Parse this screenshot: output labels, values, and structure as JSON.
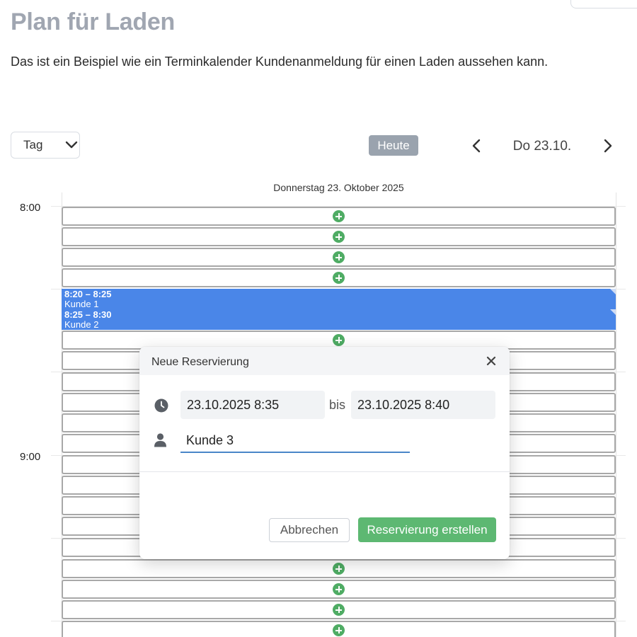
{
  "page": {
    "title": "Plan für Laden",
    "description": "Das ist ein Beispiel wie ein Terminkalender Kundenanmeldung für einen Laden aussehen kann."
  },
  "toolbar": {
    "view_label": "Tag",
    "today_label": "Heute",
    "current_date": "Do 23.10."
  },
  "calendar": {
    "day_header": "Donnerstag 23. Oktober 2025",
    "time_labels": [
      "8:00",
      "9:00"
    ],
    "events": [
      {
        "time": "8:20 – 8:25",
        "name": "Kunde 1"
      },
      {
        "time": "8:25 – 8:30",
        "name": "Kunde 2"
      }
    ]
  },
  "modal": {
    "title": "Neue Reservierung",
    "start_value": "23.10.2025  8:35",
    "separator": "bis",
    "end_value": "23.10.2025  8:40",
    "name_value": "Kunde 3",
    "cancel_label": "Abbrechen",
    "submit_label": "Reservierung erstellen"
  },
  "colors": {
    "event": "#4a86e8",
    "add_icon": "#4fac64",
    "submit": "#5db872",
    "today_button": "#9aa3ae",
    "title": "#a0a6b1"
  },
  "icons": [
    "chevron-down-icon",
    "chevron-left-icon",
    "chevron-right-icon",
    "plus-circle-icon",
    "close-icon",
    "clock-icon",
    "user-icon"
  ]
}
